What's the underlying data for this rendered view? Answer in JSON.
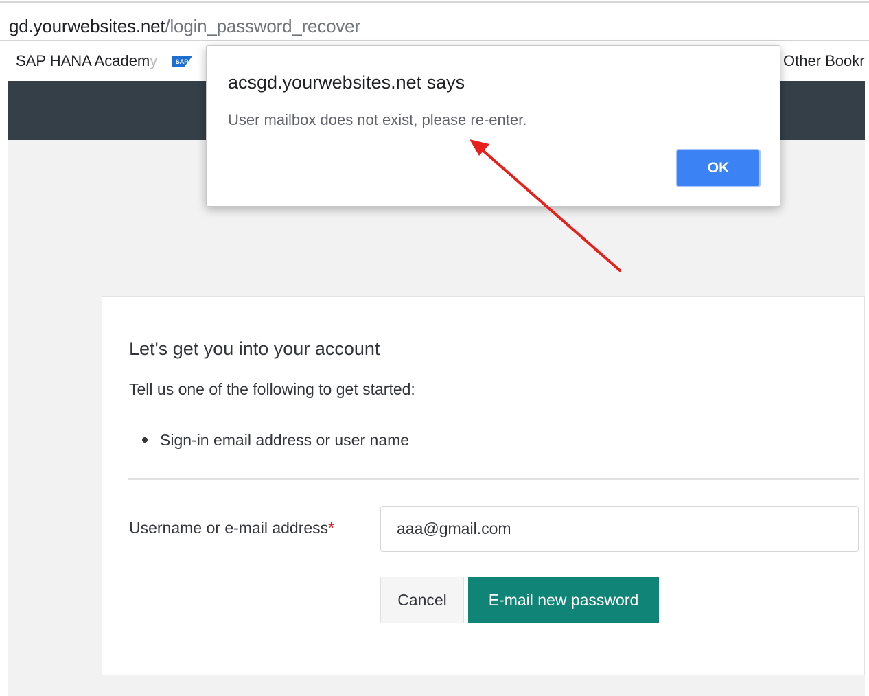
{
  "browser": {
    "url_host": "gd.yourwebsites.net",
    "url_path": "/login_password_recover",
    "bookmarks": {
      "sap_label_main": "SAP HANA Academ",
      "sap_label_fade": "y",
      "sap_logo_text": "SAP",
      "other_label": "Other Bookr"
    }
  },
  "dialog": {
    "title": "acsgd.yourwebsites.net says",
    "message": "User mailbox does not exist, please re-enter.",
    "ok_label": "OK"
  },
  "card": {
    "title": "Let's get you into your account",
    "subtitle": "Tell us one of the following to get started:",
    "bullets": [
      "Sign-in email address or user name"
    ],
    "field_label": "Username or e-mail address",
    "required_mark": "*",
    "field_value": "aaa@gmail.com",
    "cancel_label": "Cancel",
    "submit_label": "E-mail new password"
  },
  "colors": {
    "header_band": "#343f48",
    "primary_button": "#108477",
    "dialog_ok": "#3b82f5",
    "annotation_arrow": "#e8201c"
  },
  "icons": [
    "sap-logo-icon",
    "annotation-arrow-icon"
  ]
}
